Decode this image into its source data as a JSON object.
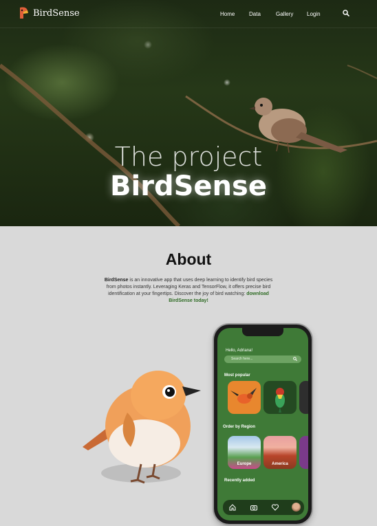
{
  "nav": {
    "brand": "BirdSense",
    "links": [
      "Home",
      "Data",
      "Gallery",
      "Login"
    ]
  },
  "hero": {
    "line1": "The project",
    "line2": "BirdSense"
  },
  "about": {
    "title": "About",
    "brand": "BirdSense",
    "text": " is an innovative app that uses deep learning to identify bird species from photos instantly. Leveraging Keras and TensorFlow, it offers precise bird identification at your fingertips. Discover the joy of bird watching: ",
    "link": "download BirdSense today!"
  },
  "phone": {
    "greeting": "Hello, Adriana!",
    "search_placeholder": "Search here...",
    "most_popular": "Most popular",
    "order_by_region": "Order by Region",
    "regions": [
      "Europe",
      "America"
    ],
    "recently_added": "Recently added",
    "tab_icons": [
      "home-icon",
      "camera-icon",
      "heart-icon",
      "avatar"
    ]
  },
  "colors": {
    "screen_green": "#3f7a37",
    "link_green": "#2e6b24",
    "page_bg": "#d9d9d9"
  }
}
